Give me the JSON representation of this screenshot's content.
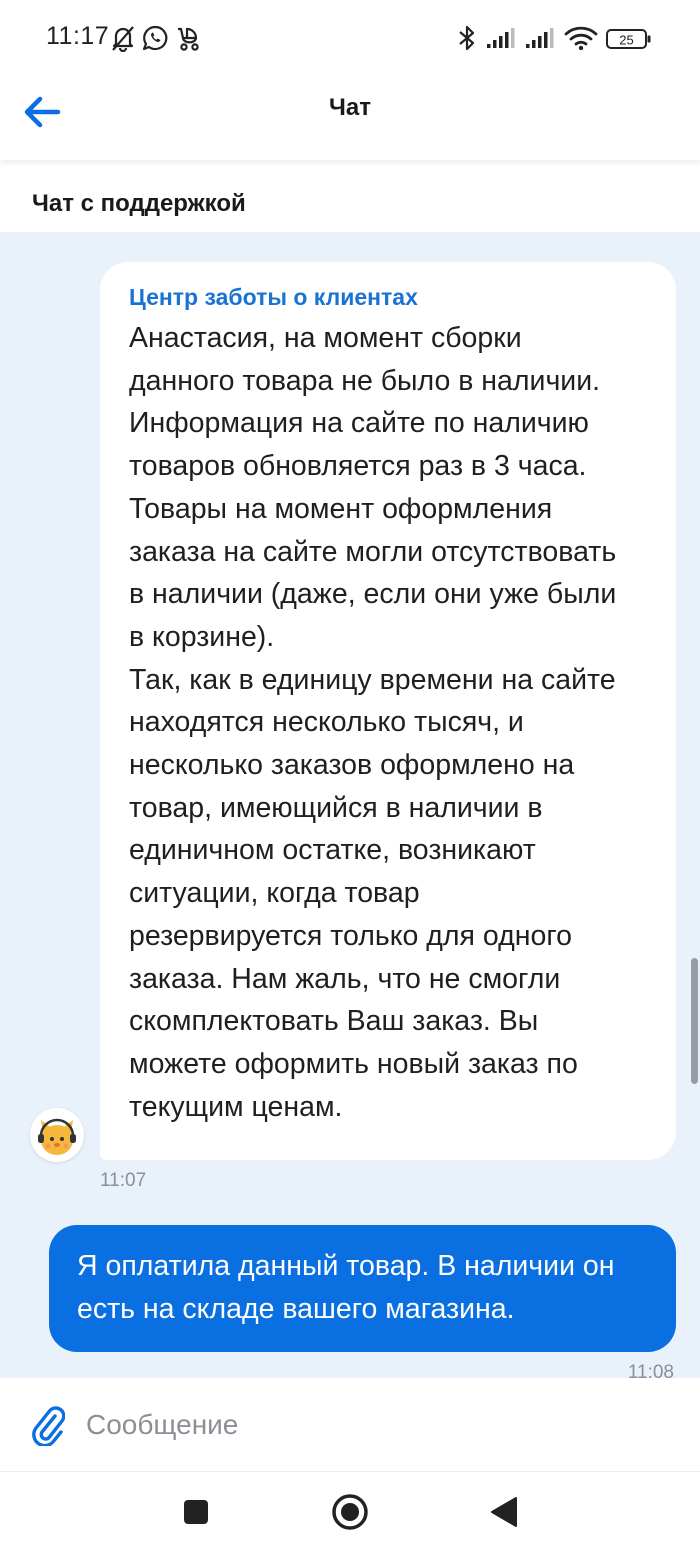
{
  "status_bar": {
    "time": "11:17",
    "battery": "25",
    "icons": [
      "mute-bell-icon",
      "whatsapp-icon",
      "stroller-icon",
      "bluetooth-icon",
      "signal-icon",
      "signal-icon",
      "wifi-icon",
      "battery-icon"
    ]
  },
  "header": {
    "back_icon": "arrow-left-icon",
    "title": "Чат"
  },
  "section_title": "Чат с поддержкой",
  "messages": [
    {
      "direction": "incoming",
      "sender": "Центр заботы о клиентах",
      "text": "Анастасия, на момент сборки\nданного товара не было в наличии.\nИнформация на сайте по наличию\nтоваров обновляется раз в 3 часа.\nТовары на момент оформления\nзаказа на сайте могли отсутствовать\nв наличии (даже, если они уже были\nв корзине).\nТак, как в единицу времени на сайте\nнаходятся несколько тысяч, и\nнесколько заказов оформлено на\nтовар, имеющийся в наличии в\nединичном остатке, возникают\nситуации, когда товар\nрезервируется только для одного\nзаказа. Нам жаль, что не смогли\nскомплектовать Ваш заказ. Вы\nможете оформить новый заказ по\nтекущим ценам.",
      "time": "11:07",
      "avatar": "support-bot-avatar"
    },
    {
      "direction": "outgoing",
      "text": "Я оплатила данный товар. В наличии он\nесть на складе вашего магазина.",
      "time": "11:08"
    }
  ],
  "composer": {
    "attach_icon": "paperclip-icon",
    "placeholder": "Сообщение"
  },
  "nav_bar": {
    "buttons": [
      "recents-square-icon",
      "home-circle-icon",
      "back-triangle-icon"
    ]
  },
  "colors": {
    "accent": "#0a6fe0",
    "sender_name": "#1a73d4",
    "chat_background": "#e9f1fb",
    "incoming_bubble": "#ffffff",
    "timestamp": "#8a8f99"
  }
}
